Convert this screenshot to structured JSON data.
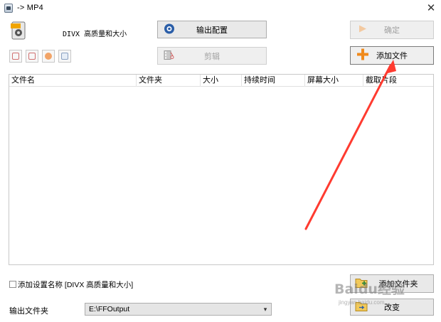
{
  "window": {
    "title": "-> MP4"
  },
  "format": {
    "label": "DIVX 高质量和大小"
  },
  "buttons": {
    "output_config": "输出配置",
    "confirm": "确定",
    "clip": "剪辑",
    "add_file": "添加文件",
    "add_folder": "添加文件夹",
    "change": "改变"
  },
  "file_list": {
    "columns": [
      "文件名",
      "文件夹",
      "大小",
      "持续时间",
      "屏幕大小",
      "截取片段"
    ]
  },
  "options": {
    "add_setting_name_label": "添加设置名称 [DIVX 高质量和大小]",
    "add_setting_name_checked": false
  },
  "output": {
    "folder_label": "输出文件夹",
    "path": "E:\\FFOutput"
  },
  "watermark": {
    "text": "Baidu经验",
    "sub": "jingyan.baidu.com"
  },
  "colors": {
    "annotation_arrow": "#ff3b30",
    "add_icon": "#f08a1c"
  }
}
